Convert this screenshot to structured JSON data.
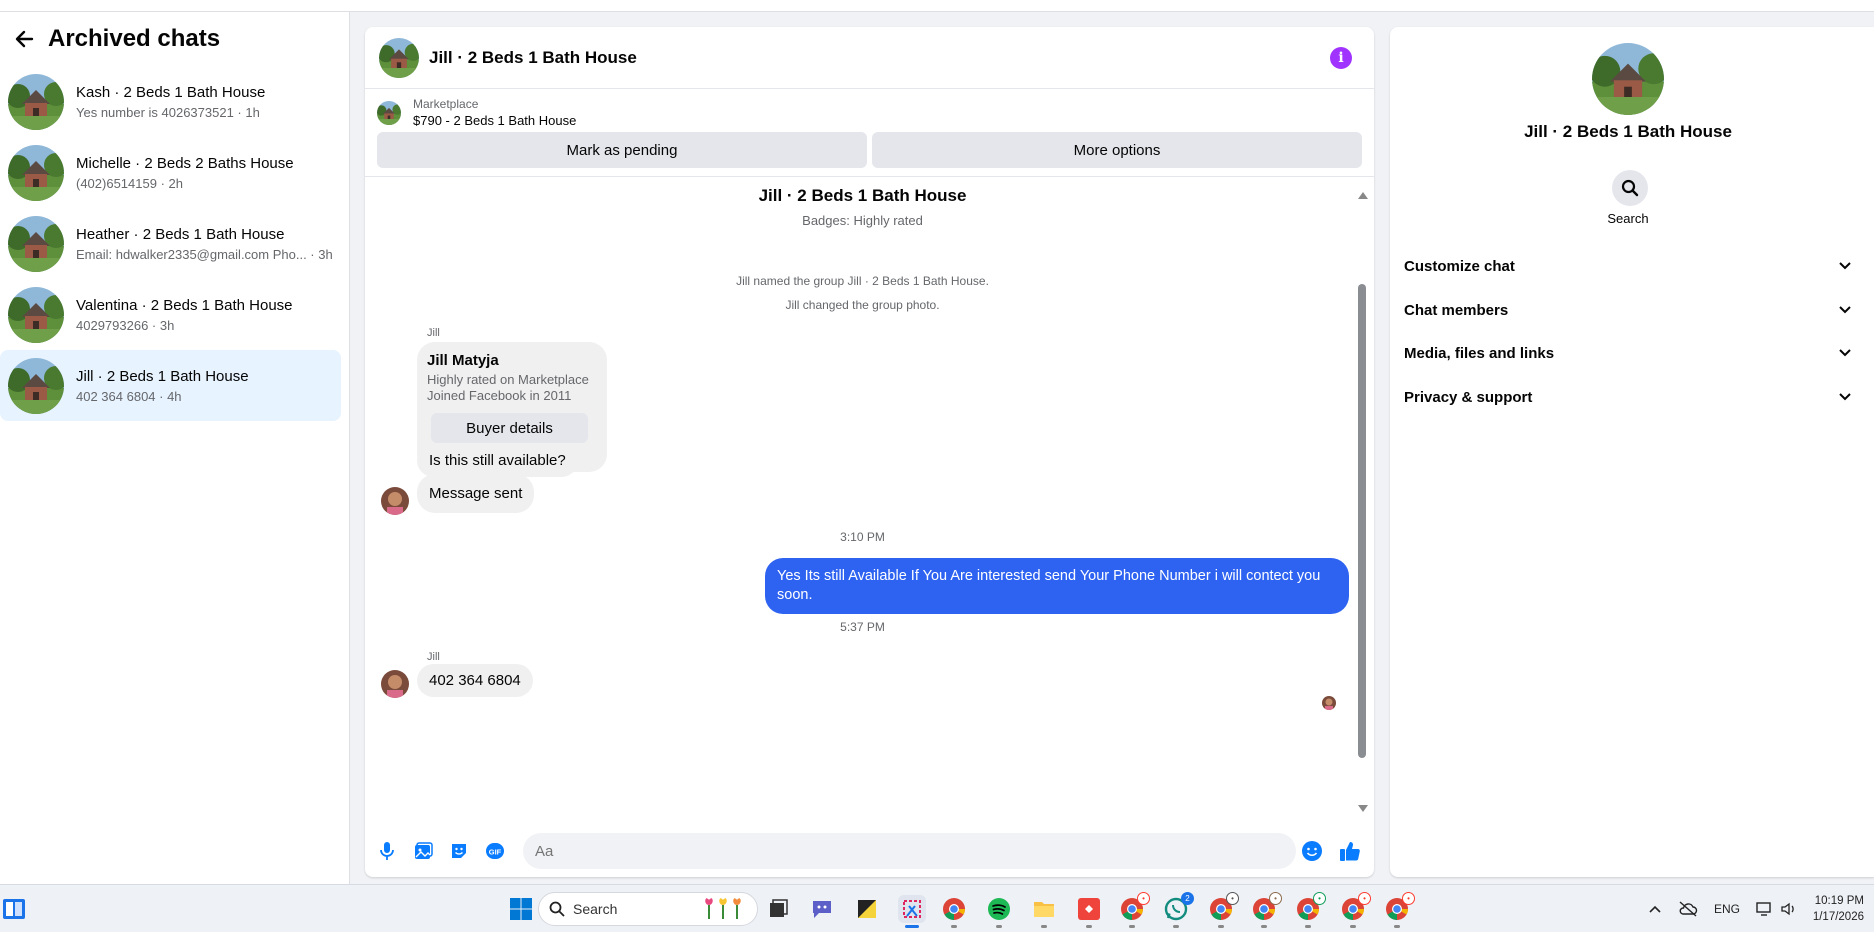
{
  "sidebar": {
    "title": "Archived chats",
    "chats": [
      {
        "name": "Kash · 2 Beds 1 Bath House",
        "sub": "Yes number is 4026373521 · 1h"
      },
      {
        "name": "Michelle · 2 Beds 2 Baths House",
        "sub": "(402)6514159 · 2h"
      },
      {
        "name": "Heather · 2 Beds 1 Bath House",
        "sub": "Email: hdwalker2335@gmail.com Pho... · 3h"
      },
      {
        "name": "Valentina · 2 Beds 1 Bath House",
        "sub": "4029793266 · 3h"
      },
      {
        "name": "Jill · 2 Beds 1 Bath House",
        "sub": "402 364 6804 · 4h"
      }
    ]
  },
  "chat": {
    "title": "Jill · 2 Beds 1 Bath House",
    "marketplace_label": "Marketplace",
    "listing": "$790 - 2 Beds 1 Bath House",
    "mark_pending": "Mark as pending",
    "more_options": "More options",
    "group_title": "Jill · 2 Beds 1 Bath House",
    "badges": "Badges: Highly rated",
    "sys_named": "Jill named the group Jill · 2 Beds 1 Bath House.",
    "sys_photo": "Jill changed the group photo.",
    "sender": "Jill",
    "card_name": "Jill Matyja",
    "card_line1": "Highly rated on Marketplace",
    "card_line2": "Joined Facebook in 2011",
    "buyer_details": "Buyer details",
    "msg_available": "Is this still available?",
    "msg_sent": "Message sent",
    "time1": "3:10 PM",
    "msg_out": "Yes Its still Available If You Are interested send Your Phone Number i will contect you soon.",
    "time2": "5:37 PM",
    "msg_phone": "402 364 6804",
    "composer_placeholder": "Aa"
  },
  "info_panel": {
    "title": "Jill · 2 Beds 1 Bath House",
    "search_label": "Search",
    "sections": [
      "Customize chat",
      "Chat members",
      "Media, files and links",
      "Privacy & support"
    ]
  },
  "taskbar": {
    "search_label": "Search",
    "lang": "ENG",
    "time": "10:19 PM",
    "date": "1/17/2026",
    "whatsapp_badge": "2"
  },
  "colors": {
    "accent": "#2e63f2",
    "info": "#a033ff",
    "active_chat": "#e7f3ff"
  }
}
